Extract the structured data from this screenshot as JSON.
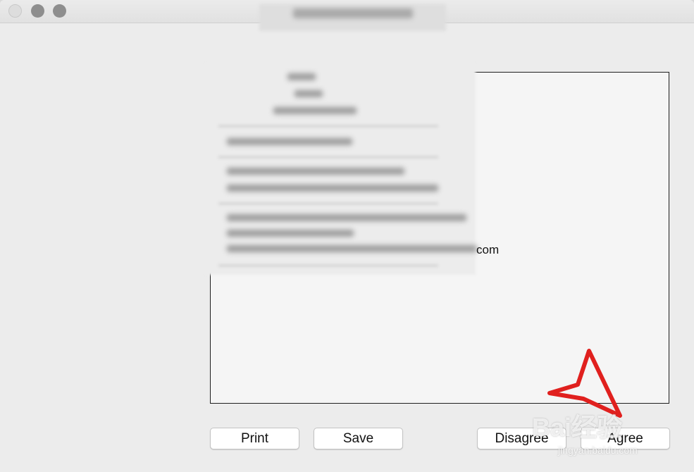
{
  "window": {
    "controls": [
      "close-icon",
      "minimize-icon",
      "zoom-icon"
    ]
  },
  "license": {
    "visible_fragment": "com"
  },
  "buttons": {
    "print": "Print",
    "save": "Save",
    "disagree": "Disagree",
    "agree": "Agree"
  },
  "annotation": {
    "arrow_color": "#e0201e"
  },
  "watermark": {
    "logo_text": "Bai经验",
    "sub_text": "jingyan.baidu.com"
  }
}
